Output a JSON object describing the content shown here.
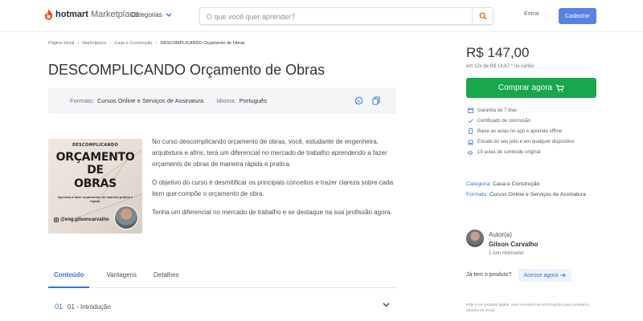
{
  "header": {
    "logo_bold": "hotmart",
    "logo_light": "Marketplace",
    "categories_label": "Categorias",
    "search_placeholder": "O que você quer aprender?",
    "login_label": "Entrar",
    "signup_label": "Cadastrar"
  },
  "breadcrumb": [
    "Página inicial",
    "Marketplace",
    "Casa e Construção",
    "DESCOMPLICANDO Orçamento de Obras"
  ],
  "product": {
    "title": "DESCOMPLICANDO Orçamento de Obras",
    "format_label": "Formato:",
    "format_value": "Cursos Online e Serviços de Assinatura",
    "language_label": "Idioma:",
    "language_value": "Português"
  },
  "course_image": {
    "top_text": "DESCOMPLICANDO",
    "line1": "ORÇAMENTO",
    "line2": "DE",
    "line3": "OBRAS",
    "subtitle": "Aprenda a fazer orçamentos de maneira prática e rápida.",
    "handle": "@eng.gilsoncarvalho"
  },
  "description": [
    "No curso descomplicando orçamento de obras, você, estudante de engenheira, arquitetura e afins, terá um diferencial no mercado de trabalho aprendendo a fazer orçamento de obras de maneira rápida e pratica.",
    "O objetivo do curso é desmitificar os principais conceitos e trazer clareza sobre cada item que compõe o orçamento de obra.",
    "Tenha um diferencial no mercado de trabalho e se destaque na sua profissão agora."
  ],
  "tabs": [
    "Conteúdo",
    "Vantagens",
    "Detalhes"
  ],
  "module": {
    "number": "01",
    "title": "01 - Introdução"
  },
  "pricing": {
    "price": "R$ 147,00",
    "installments": "em 12x de R$ 14,67 * no cartão",
    "buy_label": "Comprar agora"
  },
  "features": [
    "Garantia de 7 dias",
    "Certificado de conclusão",
    "Baixe as aulas no app e aprenda offline",
    "Estude do seu jeito e em qualquer dispositivo",
    "19 aulas de conteúdo original"
  ],
  "meta": {
    "category_label": "Categoria:",
    "category_value": "Casa e Construção",
    "format_label": "Formato:",
    "format_value": "Cursos Online e Serviços de Assinatura"
  },
  "author": {
    "label": "Autor(a)",
    "name": "Gilson Carvalho",
    "since": "1 Ano Hotmarter"
  },
  "access": {
    "question": "Já tem o produto?",
    "button": "Acesse agora"
  },
  "disclaimer": "Este é um produto digital, você receberá as informações para acessá-lo através do email.",
  "colors": {
    "accent_blue": "#3b6fe0",
    "buy_green": "#18a74b",
    "signup_blue": "#5981e3",
    "logo_orange": "#f04e23"
  }
}
